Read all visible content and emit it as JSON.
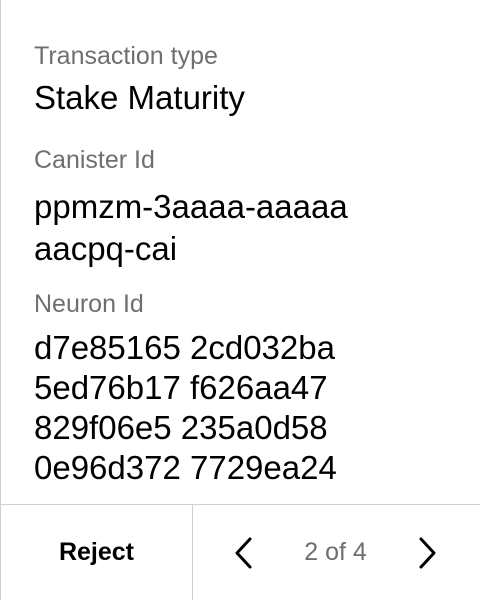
{
  "fields": {
    "transaction_type": {
      "label": "Transaction type",
      "value": "Stake Maturity"
    },
    "canister_id": {
      "label": "Canister Id",
      "value": "ppmzm-3aaaa-aaaaa\naacpq-cai"
    },
    "neuron_id": {
      "label": "Neuron Id",
      "value": "d7e85165 2cd032ba\n5ed76b17 f626aa47\n829f06e5 235a0d58\n0e96d372 7729ea24"
    }
  },
  "footer": {
    "reject_label": "Reject",
    "pager_text": "2 of 4",
    "prev_icon": "chevron-left-icon",
    "next_icon": "chevron-right-icon"
  },
  "colors": {
    "label_gray": "#6f6f6f",
    "divider": "#cfcfcf",
    "text": "#000000",
    "background": "#ffffff"
  }
}
